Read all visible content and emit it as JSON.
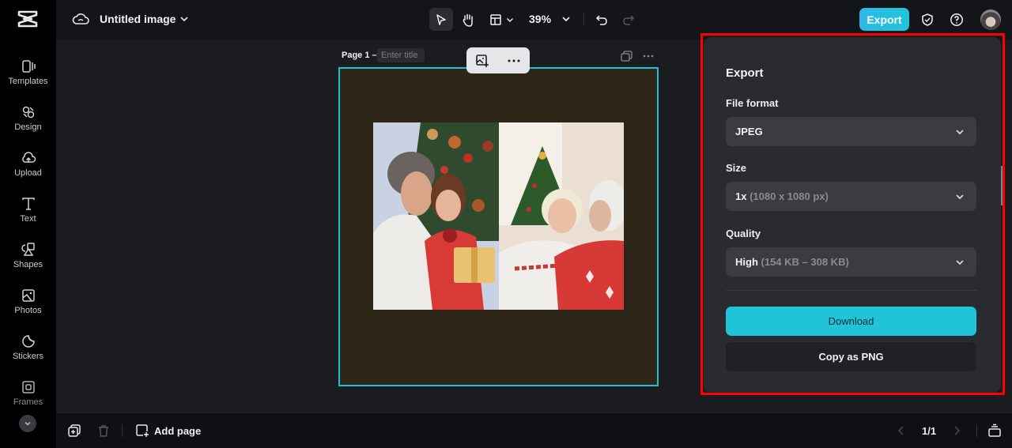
{
  "app": {
    "document_title": "Untitled image",
    "colors": {
      "accent": "#21c3d9",
      "export_button": "#2fb9e6",
      "highlight_outline": "#ff0000",
      "page_background": "#2e2619",
      "selection": "#1fc0d6"
    }
  },
  "rail": {
    "items": [
      {
        "label": "Templates",
        "icon": "templates-icon"
      },
      {
        "label": "Design",
        "icon": "design-icon"
      },
      {
        "label": "Upload",
        "icon": "upload-icon"
      },
      {
        "label": "Text",
        "icon": "text-icon"
      },
      {
        "label": "Shapes",
        "icon": "shapes-icon"
      },
      {
        "label": "Photos",
        "icon": "photos-icon"
      },
      {
        "label": "Stickers",
        "icon": "stickers-icon"
      },
      {
        "label": "Frames",
        "icon": "frames-icon"
      }
    ]
  },
  "toolbar": {
    "zoom": "39%",
    "export_label": "Export"
  },
  "canvas": {
    "page_label": "Page 1 –",
    "title_placeholder": "Enter title"
  },
  "export_panel": {
    "title": "Export",
    "file_format": {
      "label": "File format",
      "value": "JPEG"
    },
    "size": {
      "label": "Size",
      "value": "1x",
      "detail": "(1080 x 1080 px)"
    },
    "quality": {
      "label": "Quality",
      "value": "High",
      "detail": "(154 KB – 308 KB)"
    },
    "download_label": "Download",
    "copy_label": "Copy as PNG"
  },
  "bottombar": {
    "add_page_label": "Add page",
    "page_indicator": "1/1"
  }
}
